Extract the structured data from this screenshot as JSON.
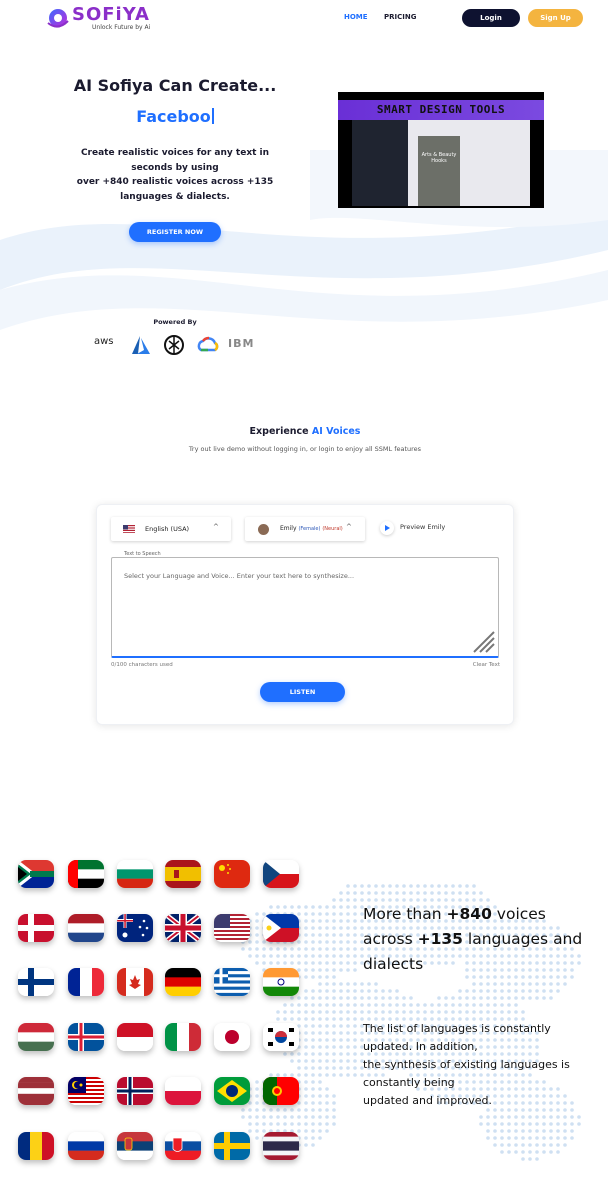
{
  "header": {
    "logo_text": "SOFiYA",
    "logo_tagline": "Unlock Future by Ai",
    "nav": {
      "home": "HOME",
      "pricing": "PRICING"
    },
    "login_label": "Login",
    "signup_label": "Sign Up"
  },
  "hero": {
    "title": "AI Sofiya Can Create...",
    "typed_text": "Faceboo",
    "description_lines": [
      "Create realistic voices for any text in",
      "seconds by using",
      "over +840 realistic voices across +135",
      "languages & dialects."
    ],
    "register_label": "REGISTER NOW",
    "video_title": "SMART DESIGN TOOLS",
    "video_caption": "Arts & Beauty Hooks",
    "powered_by": "Powered By",
    "providers": [
      "aws",
      "azure-icon",
      "openai-icon",
      "google-cloud-icon",
      "IBM"
    ]
  },
  "experience": {
    "title_prefix": "Experience ",
    "title_accent": "AI Voices",
    "subtitle": "Try out live demo without logging in, or login to enjoy all SSML features",
    "language_select": "English (USA)",
    "voice_name": "Emily",
    "voice_gender": "(Female)",
    "voice_engine": "(Neural)",
    "preview_label": "Preview Emily",
    "textarea_label": "Text to Speech",
    "textarea_placeholder": "Select your Language and Voice... Enter your text here to synthesize...",
    "char_count": "0/100 characters used",
    "clear_label": "Clear Text",
    "listen_label": "LISTEN"
  },
  "languages": {
    "headline_parts": [
      "More than ",
      "+840",
      " voices across ",
      "+135",
      " languages and dialects"
    ],
    "body_lines": [
      "The list of languages is constantly",
      "updated. In addition,",
      "the synthesis of existing languages is",
      "constantly being",
      "updated and improved."
    ],
    "flags": [
      "south-africa",
      "uae",
      "bulgaria",
      "spain",
      "china",
      "czech-republic",
      "denmark",
      "netherlands",
      "australia",
      "united-kingdom",
      "usa",
      "philippines",
      "finland",
      "france",
      "canada",
      "germany",
      "greece",
      "india",
      "hungary",
      "iceland",
      "indonesia",
      "italy",
      "japan",
      "south-korea",
      "latvia",
      "malaysia",
      "norway",
      "poland",
      "brazil",
      "portugal",
      "romania",
      "russia",
      "serbia",
      "slovakia",
      "sweden",
      "thailand"
    ]
  },
  "colors": {
    "primary": "#1f6fff",
    "dark": "#0e1230",
    "accent": "#f4b43f",
    "brand": "#8b2fc9"
  }
}
